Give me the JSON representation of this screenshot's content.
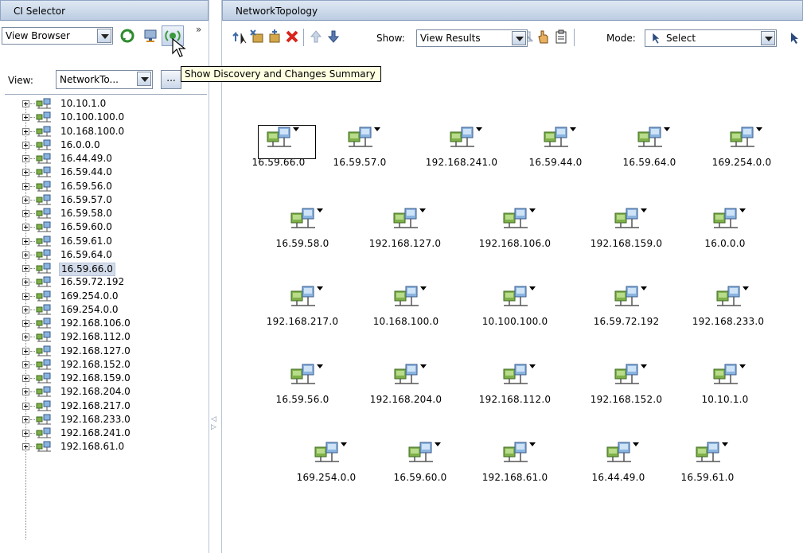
{
  "left_panel": {
    "title": "CI Selector",
    "browser_combo": "View Browser",
    "chevrons": "»",
    "view_label": "View:",
    "view_value": "NetworkTo...",
    "more_label": "...",
    "selected": "16.59.66.0",
    "tree_items": [
      "10.10.1.0",
      "10.100.100.0",
      "10.168.100.0",
      "16.0.0.0",
      "16.44.49.0",
      "16.59.44.0",
      "16.59.56.0",
      "16.59.57.0",
      "16.59.58.0",
      "16.59.60.0",
      "16.59.61.0",
      "16.59.64.0",
      "16.59.66.0",
      "16.59.72.192",
      "169.254.0.0",
      "169.254.0.0",
      "192.168.106.0",
      "192.168.112.0",
      "192.168.127.0",
      "192.168.152.0",
      "192.168.159.0",
      "192.168.204.0",
      "192.168.217.0",
      "192.168.233.0",
      "192.168.241.0",
      "192.168.61.0"
    ]
  },
  "right_panel": {
    "title": "NetworkTopology",
    "show_label": "Show:",
    "show_value": "View Results",
    "mode_label": "Mode:",
    "mode_value": "Select"
  },
  "tooltip": "Show Discovery and Changes Summary",
  "nodes": [
    [
      "16.59.66.0",
      "16.59.57.0",
      "192.168.241.0",
      "16.59.44.0",
      "16.59.64.0",
      "169.254.0.0"
    ],
    [
      "16.59.58.0",
      "192.168.127.0",
      "192.168.106.0",
      "192.168.159.0",
      "16.0.0.0"
    ],
    [
      "192.168.217.0",
      "10.168.100.0",
      "10.100.100.0",
      "16.59.72.192",
      "192.168.233.0"
    ],
    [
      "16.59.56.0",
      "192.168.204.0",
      "192.168.112.0",
      "192.168.152.0",
      "10.10.1.0"
    ],
    [
      "169.254.0.0",
      "16.59.60.0",
      "192.168.61.0",
      "16.44.49.0",
      "16.59.61.0"
    ]
  ],
  "colors": {
    "header_bg": "#c9d7ea",
    "selection": "#d3dcea",
    "tooltip_bg": "#ffffe1",
    "delete_red": "#d8261c",
    "network_icon_green": "#5c8c3c"
  }
}
